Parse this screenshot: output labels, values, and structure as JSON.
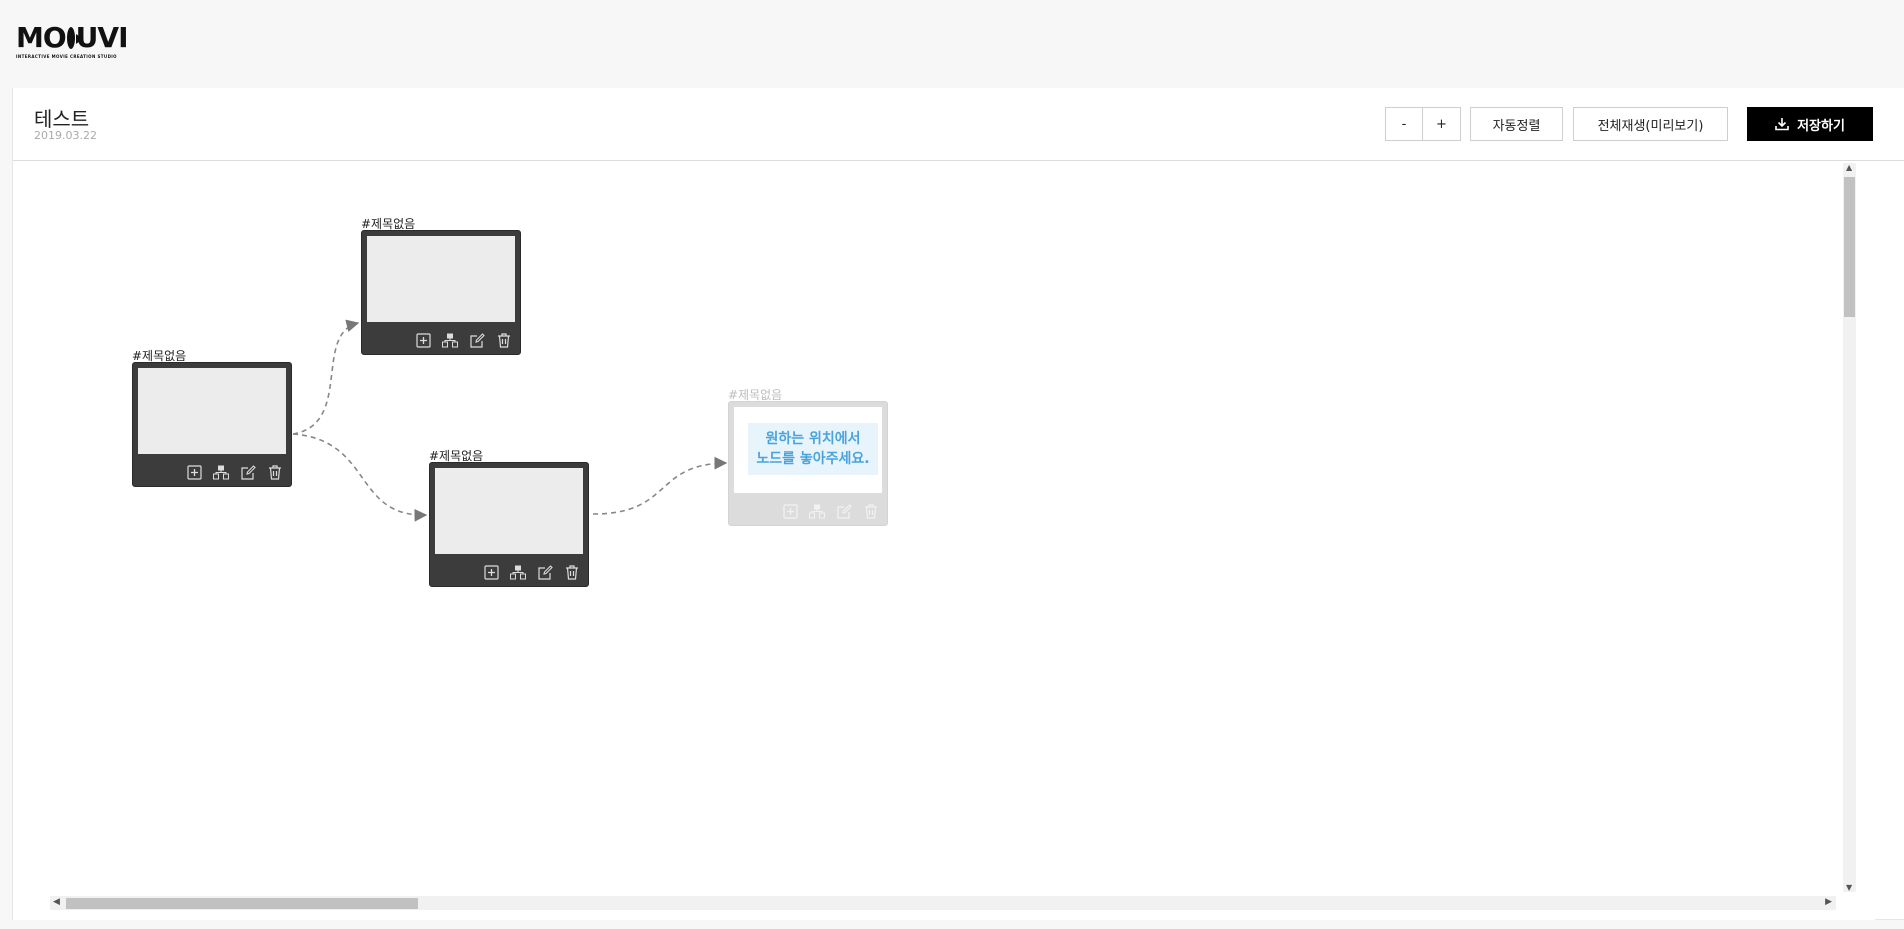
{
  "logo": {
    "word_pre": "MO",
    "word_post": "UVI",
    "subtitle": "INTERACTIVE MOVIE CREATION STUDIO"
  },
  "project": {
    "title": "테스트",
    "date": "2019.03.22"
  },
  "toolbar": {
    "zoom_out_label": "-",
    "zoom_in_label": "+",
    "auto_align_label": "자동정렬",
    "preview_label": "전체재생(미리보기)",
    "save_label": "저장하기"
  },
  "nodes": [
    {
      "label": "#제목없음"
    },
    {
      "label": "#제목없음"
    },
    {
      "label": "#제목없음"
    }
  ],
  "ghost_node": {
    "label": "#제목없음",
    "hint_line1": "원하는 위치에서",
    "hint_line2": "노드를 놓아주세요."
  },
  "node_actions": [
    "add-icon",
    "branch-icon",
    "edit-icon",
    "trash-icon"
  ],
  "colors": {
    "node_body": "#3c3c3c",
    "node_screen": "#ececec",
    "ghost_hint_text": "#4aa3dc",
    "save_button": "#000000"
  }
}
